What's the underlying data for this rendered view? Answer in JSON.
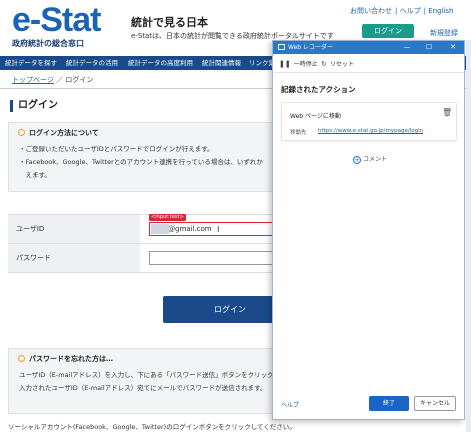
{
  "site": {
    "logo_text": "e-Stat",
    "logo_sub": "政府統計の総合窓口",
    "tagline_title": "統計で見る日本",
    "tagline_desc": "e-Statは、日本の統計が閲覧できる政府統計ポータルサイトです",
    "top_links": [
      "お問い合わせ",
      "ヘルプ",
      "English"
    ],
    "top_login": "ログイン",
    "new_registration": "新規登録",
    "nav": [
      "統計データを探す",
      "統計データの活用",
      "統計データの高度利用",
      "統計関連情報",
      "リンク集"
    ]
  },
  "breadcrumb": {
    "home": "トップページ",
    "separator": "／",
    "current": "ログイン"
  },
  "page": {
    "title": "ログイン",
    "method_box": {
      "heading": "ログイン方法について",
      "lines": [
        "・ご登録いただいたユーザIDとパスワードでログインが行えます。",
        "・Facebook、Google、Twitterとのアカウント連携を行っている場合は、いずれか",
        "　えます。"
      ]
    },
    "form": {
      "user_id_label": "ユーザID",
      "user_id_value": "@gmail.com",
      "input_tag": "<input:text>",
      "password_label": "パスワード",
      "password_value": ""
    },
    "login_button": "ログイン",
    "forgot_box": {
      "heading": "パスワードを忘れた方は…",
      "lines": [
        "ユーザID（E-mailアドレス）を入力し、下にある「パスワード送信」ボタンをクリック",
        "入力されたユーザID（E-mailアドレス）宛てにメールでパスワードが送信されます。"
      ]
    },
    "bottom_text": "ソーシャルアカウント(Facebook、Google、Twitter)のログインボタンをクリックしてください。"
  },
  "recorder": {
    "title": "Web レコーダー",
    "pause": "一時停止",
    "reset": "リセット",
    "heading": "記録されたアクション",
    "action_title": "Web ページに移動",
    "action_url_label": "移動先",
    "action_url": "https://www.e-stat.go.jp/mypage/login",
    "comment": "コメント",
    "help": "ヘルプ",
    "done": "終了",
    "cancel": "キャンセル"
  },
  "colors": {
    "brand_blue": "#1a64b4",
    "nav_bg": "#1a4a8a",
    "highlight_red": "#d9263b",
    "recorder_title_bg": "#2a79c9"
  }
}
